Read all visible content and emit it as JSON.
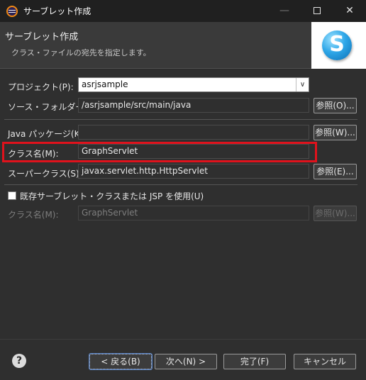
{
  "window": {
    "title": "サーブレット作成"
  },
  "banner": {
    "title": "サーブレット作成",
    "description": "クラス・ファイルの宛先を指定します。",
    "logo_letter": "S"
  },
  "form": {
    "project_label": "プロジェクト(P):",
    "project_value": "asrjsample",
    "source_folder_label": "ソース・フォルダー(D):",
    "source_folder_value": "/asrjsample/src/main/java",
    "java_package_label": "Java パッケージ(K):",
    "java_package_value": "",
    "class_name_label": "クラス名(M):",
    "class_name_value": "GraphServlet",
    "superclass_label": "スーパークラス(S):",
    "superclass_value": "javax.servlet.http.HttpServlet",
    "use_existing_label": "既存サーブレット・クラスまたは JSP を使用(U)",
    "use_existing_checked": false,
    "existing_class_label": "クラス名(M):",
    "existing_class_value": "GraphServlet",
    "browse_o": "参照(O)...",
    "browse_w": "参照(W)...",
    "browse_e": "参照(E)...",
    "browse_w2": "参照(W)..."
  },
  "footer": {
    "back": "< 戻る(B)",
    "next": "次へ(N) >",
    "finish": "完了(F)",
    "cancel": "キャンセル"
  },
  "colors": {
    "highlight": "#e0121c",
    "background": "#2f2f2f"
  }
}
